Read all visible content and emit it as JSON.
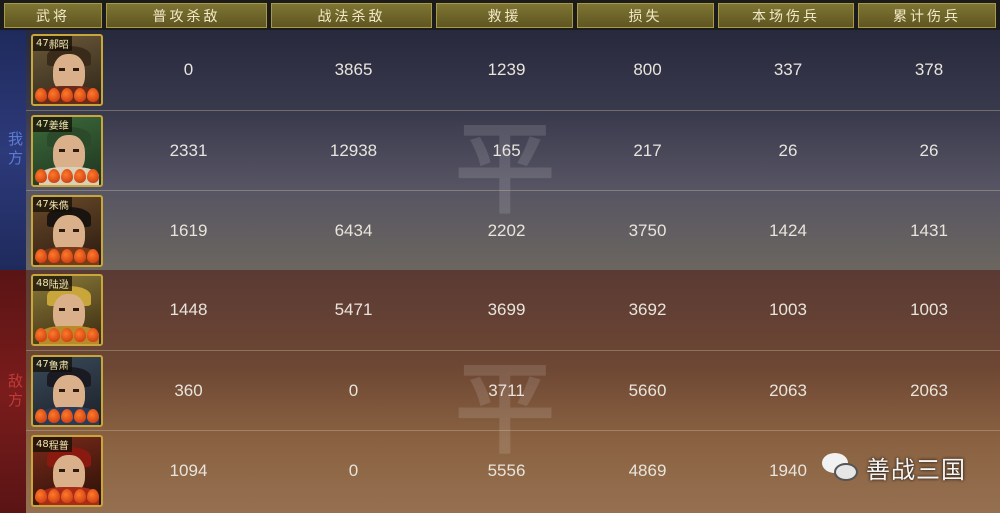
{
  "columns": [
    "武将",
    "普攻杀敌",
    "战法杀敌",
    "救援",
    "损失",
    "本场伤兵",
    "累计伤兵"
  ],
  "sides": {
    "ally_label": "我方",
    "enemy_label": "敌方",
    "watermark": "平"
  },
  "ally_rows": [
    {
      "level": "47",
      "name": "郝昭",
      "attack_kills": "0",
      "tactic_kills": "3865",
      "rescue": "1239",
      "loss": "800",
      "wounded_battle": "337",
      "wounded_total": "378"
    },
    {
      "level": "47",
      "name": "姜维",
      "attack_kills": "2331",
      "tactic_kills": "12938",
      "rescue": "165",
      "loss": "217",
      "wounded_battle": "26",
      "wounded_total": "26"
    },
    {
      "level": "47",
      "name": "朱儁",
      "attack_kills": "1619",
      "tactic_kills": "6434",
      "rescue": "2202",
      "loss": "3750",
      "wounded_battle": "1424",
      "wounded_total": "1431"
    }
  ],
  "enemy_rows": [
    {
      "level": "48",
      "name": "陆逊",
      "attack_kills": "1448",
      "tactic_kills": "5471",
      "rescue": "3699",
      "loss": "3692",
      "wounded_battle": "1003",
      "wounded_total": "1003"
    },
    {
      "level": "47",
      "name": "鲁肃",
      "attack_kills": "360",
      "tactic_kills": "0",
      "rescue": "3711",
      "loss": "5660",
      "wounded_battle": "2063",
      "wounded_total": "2063"
    },
    {
      "level": "48",
      "name": "程普",
      "attack_kills": "1094",
      "tactic_kills": "0",
      "rescue": "5556",
      "loss": "4869",
      "wounded_battle": "1940",
      "wounded_total": ""
    }
  ],
  "overlay": {
    "account_name": "善战三国",
    "icon": "wechat-icon"
  }
}
